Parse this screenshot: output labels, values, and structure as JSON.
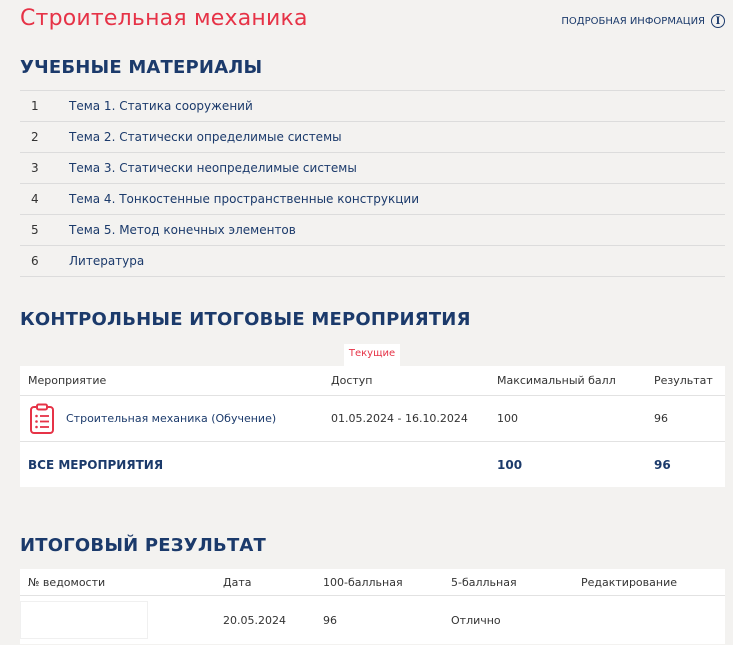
{
  "header": {
    "title": "Строительная механика",
    "more_info": "ПОДРОБНАЯ ИНФОРМАЦИЯ",
    "info_glyph": "i"
  },
  "materials": {
    "title": "УЧЕБНЫЕ МАТЕРИАЛЫ",
    "items": [
      {
        "num": "1",
        "label": "Тема 1. Статика сооружений"
      },
      {
        "num": "2",
        "label": "Тема 2. Статически определимые системы"
      },
      {
        "num": "3",
        "label": "Тема 3. Статически неопределимые системы"
      },
      {
        "num": "4",
        "label": "Тема 4. Тонкостенные пространственные конструкции"
      },
      {
        "num": "5",
        "label": "Тема 5. Метод конечных элементов"
      },
      {
        "num": "6",
        "label": "Литература"
      }
    ]
  },
  "events": {
    "title": "КОНТРОЛЬНЫЕ ИТОГОВЫЕ МЕРОПРИЯТИЯ",
    "tab_current": "Текущие",
    "columns": [
      "Мероприятие",
      "Доступ",
      "Максимальный балл",
      "Результат"
    ],
    "rows": [
      {
        "icon": "clipboard-list-icon",
        "name": "Строительная механика (Обучение)",
        "access": "01.05.2024 - 16.10.2024",
        "max": "100",
        "result": "96"
      }
    ],
    "total": {
      "label": "ВСЕ МЕРОПРИЯТИЯ",
      "max": "100",
      "result": "96"
    }
  },
  "final": {
    "title": "ИТОГОВЫЙ РЕЗУЛЬТАТ",
    "columns": [
      "№ ведомости",
      "Дата",
      "100-балльная",
      "5-балльная",
      "Редактирование"
    ],
    "rows": [
      {
        "statement": "",
        "date": "20.05.2024",
        "score100": "96",
        "score5": "Отлично",
        "edit": ""
      }
    ]
  },
  "colors": {
    "accent": "#e63347",
    "navy": "#1b3a6b",
    "background": "#f3f2f0"
  }
}
